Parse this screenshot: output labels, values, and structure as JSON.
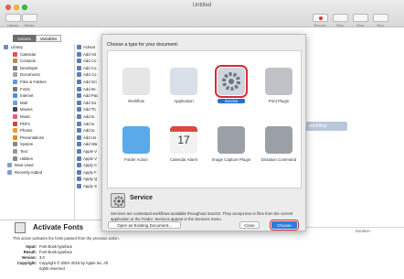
{
  "window": {
    "title": "Untitled"
  },
  "toolbar": {
    "left_labels": [
      "Library",
      "Media"
    ],
    "right_labels": [
      "Record",
      "Step",
      "Stop",
      "Run"
    ]
  },
  "library": {
    "tabs": [
      "Actions",
      "Variables"
    ],
    "items": [
      {
        "label": "Library",
        "color": "#6b8cc1"
      },
      {
        "label": "Calendar",
        "color": "#e5534b"
      },
      {
        "label": "Contacts",
        "color": "#b08c5a"
      },
      {
        "label": "Developer",
        "color": "#7c7c7c"
      },
      {
        "label": "Documents",
        "color": "#9aa7b4"
      },
      {
        "label": "Files & Folders",
        "color": "#5f9ad8"
      },
      {
        "label": "Fonts",
        "color": "#777777"
      },
      {
        "label": "Internet",
        "color": "#4d8fe0"
      },
      {
        "label": "Mail",
        "color": "#6aa2e8"
      },
      {
        "label": "Movies",
        "color": "#444444"
      },
      {
        "label": "Music",
        "color": "#e85c7a"
      },
      {
        "label": "PDFs",
        "color": "#c94a3e"
      },
      {
        "label": "Photos",
        "color": "#e4a03b"
      },
      {
        "label": "Presentations",
        "color": "#e08a2b"
      },
      {
        "label": "System",
        "color": "#888888"
      },
      {
        "label": "Text",
        "color": "#9a9a9a"
      },
      {
        "label": "Utilities",
        "color": "#7d8a99"
      },
      {
        "label": "Most Used",
        "color": "#7fa1cf"
      },
      {
        "label": "Recently Added",
        "color": "#7fa1cf"
      }
    ],
    "actions": [
      "Activat",
      "Add Att",
      "Add Co",
      "Add Co",
      "Add Co",
      "Add Gri",
      "Add Ite",
      "Add Pac",
      "Add So",
      "Add Th",
      "Add to",
      "Add to",
      "Add to",
      "Add Us",
      "Add Wa",
      "Apple V",
      "Apple V",
      "Apply C",
      "Apply F",
      "Apply Q",
      "Apply S"
    ]
  },
  "description": {
    "title": "Activate Fonts",
    "summary": "This action activates the fonts passed from the previous action.",
    "fields": [
      {
        "key": "Input:",
        "value": "Font Book typeface"
      },
      {
        "key": "Result:",
        "value": "Font Book typeface"
      },
      {
        "key": "Version:",
        "value": "3.0"
      },
      {
        "key": "Copyright:",
        "value": "Copyright © 2004–2016 by Apple Inc. All"
      },
      {
        "key": "",
        "value": "rights reserved."
      }
    ]
  },
  "workflow": {
    "hint": "workflow",
    "duration_label": "Duration"
  },
  "dialog": {
    "prompt": "Choose a type for your document:",
    "types": [
      {
        "label": "Workflow",
        "icon": "workflow-icon",
        "color": "#e6e6e6"
      },
      {
        "label": "Application",
        "icon": "robot-icon",
        "color": "#d8dfe8"
      },
      {
        "label": "Service",
        "icon": "gear-icon",
        "color": "#cfd5dc"
      },
      {
        "label": "Print Plugin",
        "icon": "printer-icon",
        "color": "#bfc3c8"
      },
      {
        "label": "Folder Action",
        "icon": "folder-icon",
        "color": "#5aa9e8"
      },
      {
        "label": "Calendar Alarm",
        "icon": "calendar-icon",
        "color": "#f2f2f2"
      },
      {
        "label": "Image Capture Plugin",
        "icon": "camera-icon",
        "color": "#9aa0a6"
      },
      {
        "label": "Dictation Command",
        "icon": "microphone-icon",
        "color": "#9aa0a6"
      }
    ],
    "selected": "Service",
    "calendar_day": "17",
    "service_title": "Service",
    "service_description": "Services are contextual workflows available throughout macOS. They accept text or files from the current application or the Finder. Services appear in the Services menu.",
    "open_existing_label": "Open an Existing Document...",
    "close_label": "Close",
    "choose_label": "Choose"
  },
  "colors": {
    "accent": "#2f7ce0",
    "highlight": "#d22d35"
  }
}
